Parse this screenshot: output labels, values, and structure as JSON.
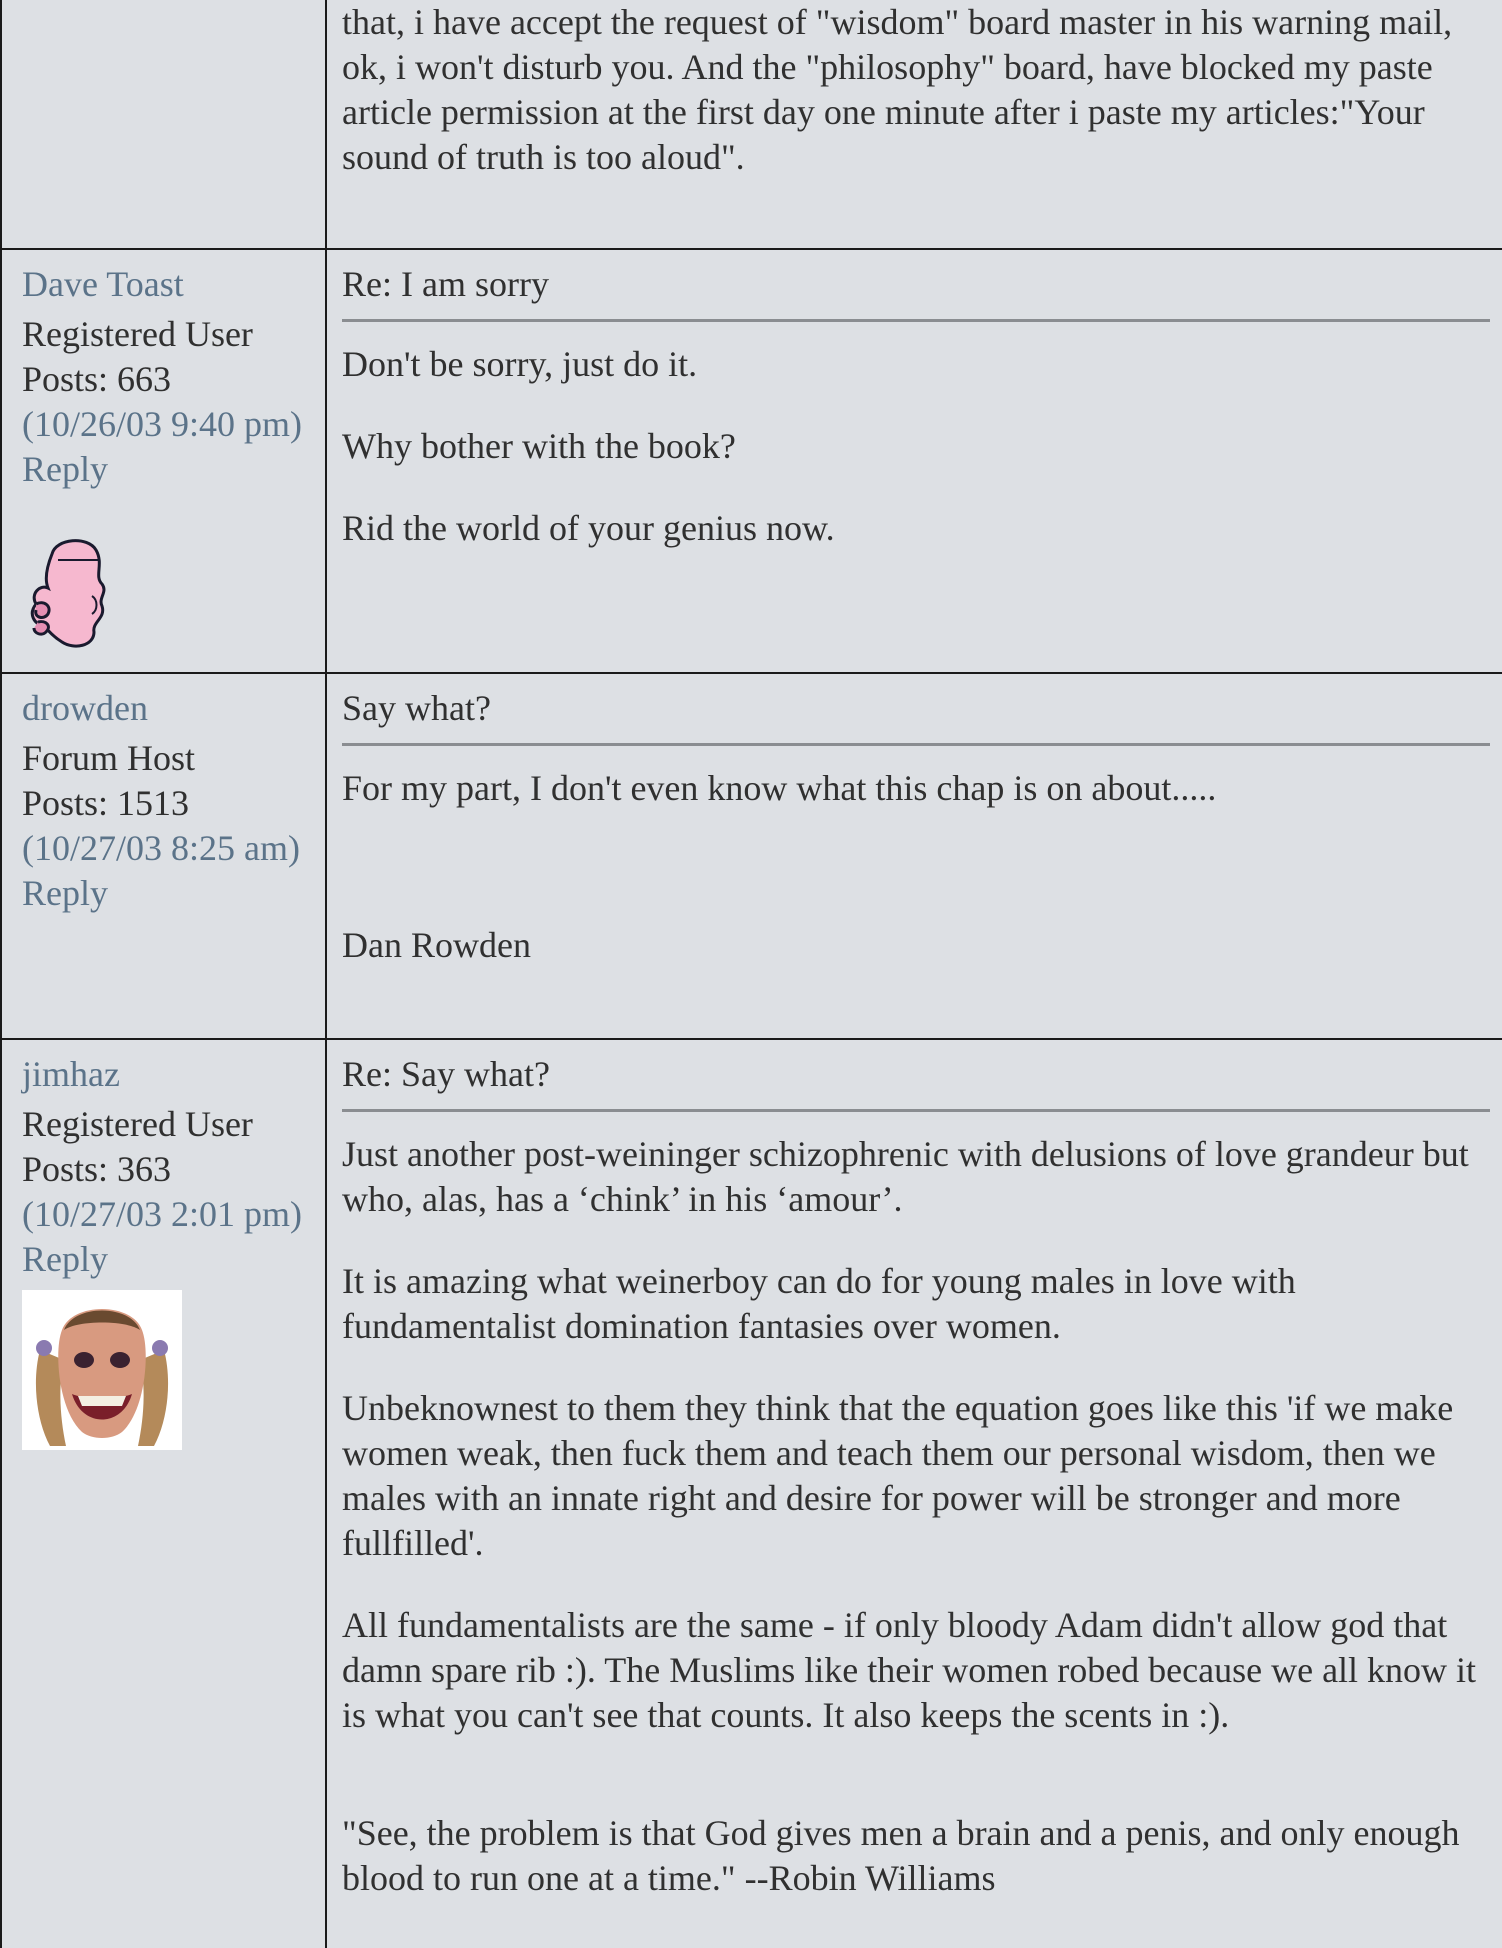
{
  "posts": [
    {
      "continued_text": "that, i have accept the request of \"wisdom\" board master in his warning mail, ok, i won't disturb you. And the \"philosophy\" board, have blocked my paste article permission at the first day one minute after i paste my articles:\"Your sound of truth is too aloud\"."
    },
    {
      "username": "Dave Toast",
      "role": "Registered User",
      "posts_count": "Posts: 663",
      "timestamp": "(10/26/03 9:40 pm)",
      "reply_label": "Reply",
      "avatar_icon": "pink-cartoon-head-avatar",
      "subject": "Re: I am sorry",
      "paragraphs": [
        "Don't be sorry, just do it.",
        "Why bother with the book?",
        "Rid the world of your genius now."
      ]
    },
    {
      "username": "drowden",
      "role": "Forum Host",
      "posts_count": "Posts: 1513",
      "timestamp": "(10/27/03 8:25 am)",
      "reply_label": "Reply",
      "subject": "Say what?",
      "paragraphs": [
        "For my part, I don't even know what this chap is on about.....",
        "Dan Rowden"
      ]
    },
    {
      "username": "jimhaz",
      "role": "Registered User",
      "posts_count": "Posts: 363",
      "timestamp": "(10/27/03 2:01 pm)",
      "reply_label": "Reply",
      "avatar_icon": "grinning-face-pigtails-avatar",
      "subject": "Re: Say what?",
      "paragraphs": [
        "Just another post-weininger schizophrenic with delusions of love grandeur but who, alas, has a ‘chink’ in his ‘amour’.",
        "It is amazing what weinerboy can do for young males in love with fundamentalist domination fantasies over women.",
        "Unbeknownest to them they think that the equation goes like this 'if we make women weak, then fuck them and teach them our personal wisdom, then we males with an innate right and desire for power will be stronger and more fullfilled'.",
        "All fundamentalists are the same - if only bloody Adam didn't allow god that damn spare rib :). The Muslims like their women robed because we all know it is what you can't see that counts. It also keeps the scents in :).",
        "\"See, the problem is that God gives men a brain and a penis, and only enough blood to run one at a time.\" --Robin Williams"
      ]
    }
  ]
}
